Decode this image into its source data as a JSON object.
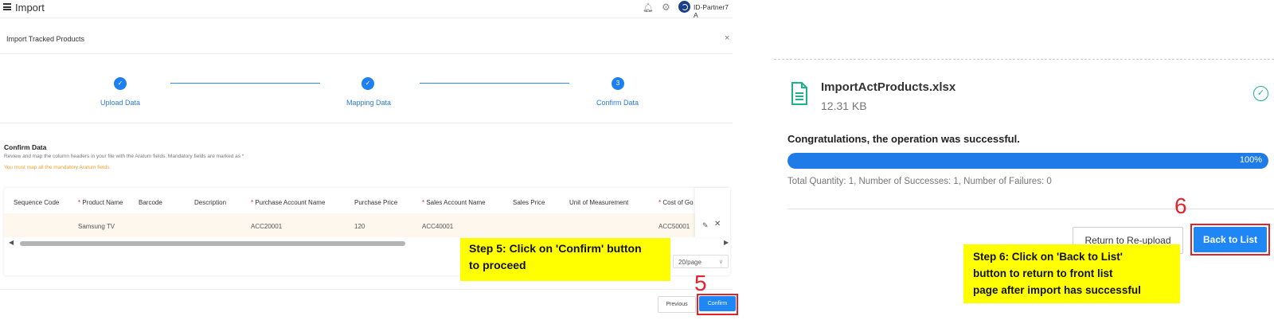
{
  "header": {
    "title": "Import",
    "user_name": "ID-Partner7 A"
  },
  "modal": {
    "title": "Import Tracked Products",
    "close": "×"
  },
  "steps": [
    {
      "label": "Upload Data",
      "marker": "✓"
    },
    {
      "label": "Mapping Data",
      "marker": "✓"
    },
    {
      "label": "Confirm Data",
      "marker": "3"
    }
  ],
  "section": {
    "title": "Confirm Data",
    "hint": "Review and map the column headers in your file with the Aratum fields. Mandatory fields are marked as *",
    "warning": "You must map all the mandatory Aratum fields."
  },
  "table": {
    "headers": [
      {
        "label": "Sequence Code",
        "required": false
      },
      {
        "label": "Product Name",
        "required": true
      },
      {
        "label": "Barcode",
        "required": false
      },
      {
        "label": "Description",
        "required": false
      },
      {
        "label": "Purchase Account Name",
        "required": true
      },
      {
        "label": "Purchase Price",
        "required": false
      },
      {
        "label": "Sales Account Name",
        "required": true
      },
      {
        "label": "Sales Price",
        "required": false
      },
      {
        "label": "Unit of Measurement",
        "required": false
      },
      {
        "label": "Cost of Go",
        "required": true
      }
    ],
    "rows": [
      [
        "",
        "Samsung TV",
        "",
        "",
        "ACC20001",
        "120",
        "ACC40001",
        "",
        "",
        "ACC50001"
      ]
    ]
  },
  "pagination": {
    "page_size": "20/page"
  },
  "buttons": {
    "previous": "Previous",
    "confirm": "Confirm"
  },
  "annotations": {
    "step5_number": "5",
    "step5_text_line1": "Step 5: Click on 'Confirm' button",
    "step5_text_line2": "to proceed",
    "step6_number": "6",
    "step6_text_line1": "Step 6: Click on 'Back to List'",
    "step6_text_line2": "button to return to front list",
    "step6_text_line3": "page after import has successful"
  },
  "result": {
    "file_name": "ImportActProducts.xlsx",
    "file_size": "12.31 KB",
    "message": "Congratulations, the operation was successful.",
    "progress_percent": 100,
    "progress_label": "100%",
    "summary": "Total Quantity: 1, Number of Successes: 1, Number of Failures: 0",
    "reupload_label": "Return to Re-upload",
    "back_label": "Back to List"
  },
  "colors": {
    "primary": "#1f86f5",
    "highlight_red": "#e0242d",
    "callout_yellow": "#ffff00",
    "success_green": "#1bb38a",
    "warning_orange": "#f0a030"
  }
}
